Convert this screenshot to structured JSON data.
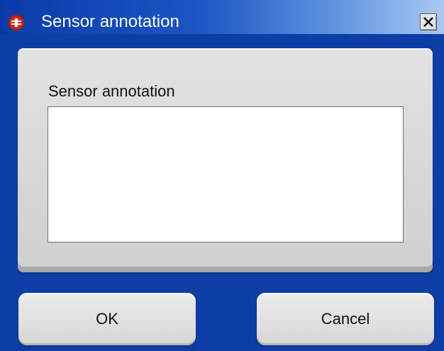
{
  "window": {
    "title": "Sensor annotation",
    "icon": "app-logo-icon",
    "close_icon": "close-icon"
  },
  "form": {
    "label": "Sensor annotation",
    "value": ""
  },
  "buttons": {
    "ok_label": "OK",
    "cancel_label": "Cancel"
  },
  "colors": {
    "window_background": "#0d3ea6",
    "title_gradient_start": "#0a3aa8",
    "title_gradient_end": "#a9c8f2",
    "panel": "#d9d9d9",
    "app_icon": "#d8281c"
  }
}
